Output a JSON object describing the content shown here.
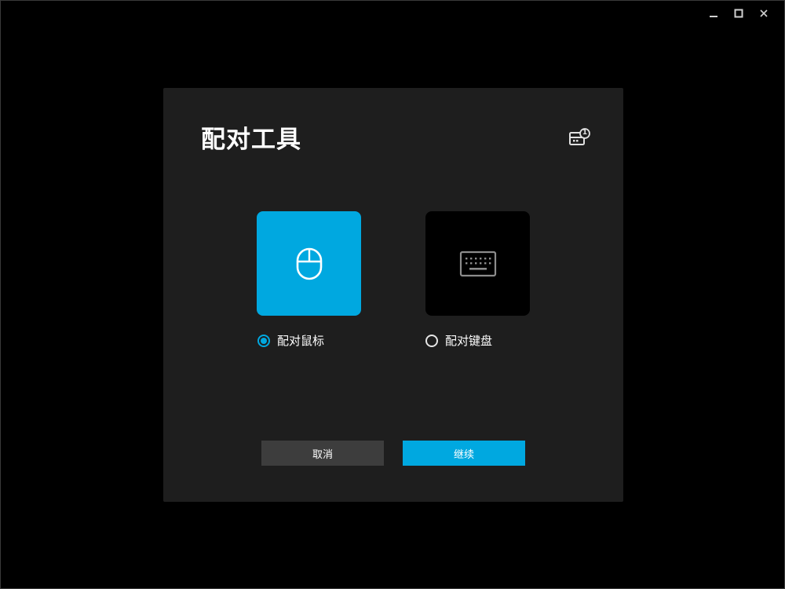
{
  "window": {
    "controls": [
      "minimize",
      "maximize",
      "close"
    ]
  },
  "dialog": {
    "title": "配对工具",
    "help_badge": "1",
    "options": [
      {
        "id": "mouse",
        "label": "配对鼠标",
        "icon": "mouse-icon",
        "selected": true
      },
      {
        "id": "keyboard",
        "label": "配对键盘",
        "icon": "keyboard-icon",
        "selected": false
      }
    ],
    "buttons": {
      "cancel": "取消",
      "continue": "继续"
    }
  },
  "colors": {
    "accent": "#00a8e0",
    "dialog_bg": "#1e1e1e",
    "cancel_bg": "#3d3d3d",
    "page_bg": "#000000"
  }
}
